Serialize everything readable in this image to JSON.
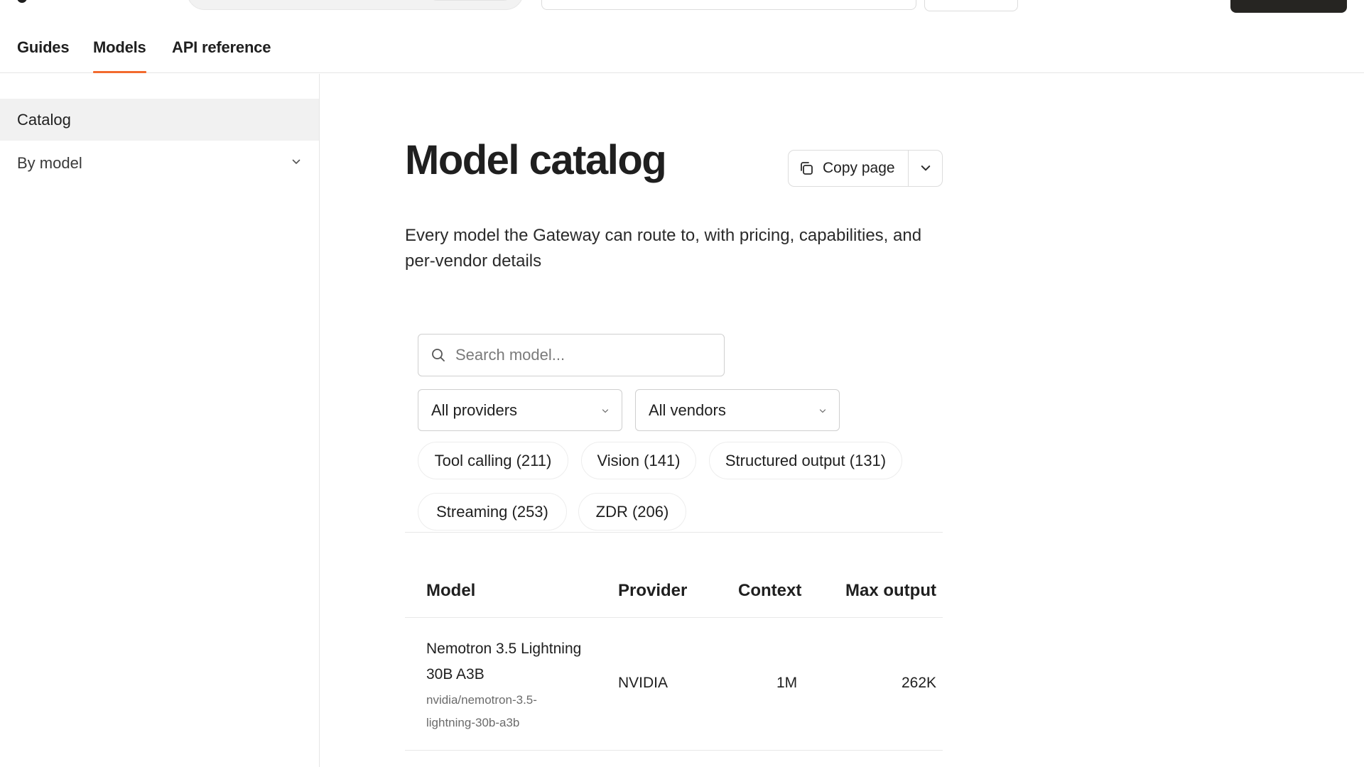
{
  "nav": {
    "tabs": [
      {
        "label": "Guides"
      },
      {
        "label": "Models"
      },
      {
        "label": "API reference"
      }
    ],
    "active_tab": "Models"
  },
  "sidebar": {
    "items": [
      {
        "label": "Catalog"
      },
      {
        "label": "By model"
      }
    ]
  },
  "main": {
    "title": "Model catalog",
    "copy_label": "Copy page",
    "description": "Every model the Gateway can route to, with pricing, capabilities, and per-vendor details"
  },
  "filters": {
    "search_placeholder": "Search model...",
    "provider_select": "All providers",
    "vendor_select": "All vendors",
    "chips": [
      {
        "label": "Tool calling (211)"
      },
      {
        "label": "Vision (141)"
      },
      {
        "label": "Structured output (131)"
      },
      {
        "label": "Streaming (253)"
      },
      {
        "label": "ZDR (206)"
      }
    ]
  },
  "table": {
    "headers": [
      "Model",
      "Provider",
      "Context",
      "Max output"
    ],
    "rows": [
      {
        "name": "Nemotron 3.5 Lightning 30B A3B",
        "id": "nvidia/nemotron-3.5-lightning-30b-a3b",
        "provider": "NVIDIA",
        "context": "1M",
        "max_output": "262K"
      }
    ]
  },
  "icons": {
    "search": "search-icon",
    "copy": "copy-icon",
    "chevron": "chevron-down-icon"
  },
  "colors": {
    "accent": "#f26a2e",
    "dark_button": "#262522",
    "active_sidebar_bg": "#f1f1f1"
  }
}
